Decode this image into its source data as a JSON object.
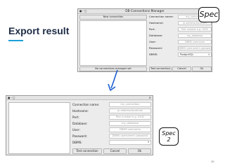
{
  "slide": {
    "title": "Export result",
    "page_number": "10"
  },
  "window_top": {
    "title": "DB Connections Manager",
    "controls": "●–▢",
    "close": "✕",
    "new_connection_button": "New connection",
    "no_connection_button": "No connections manager set",
    "form": [
      {
        "label": "Connection name:",
        "placeholder": "my_connection"
      },
      {
        "label": "Hostname:",
        "placeholder": "ip address/localhost"
      },
      {
        "label": "Port:",
        "placeholder": "Port number e.g. 5432"
      },
      {
        "label": "Database:",
        "placeholder": "my_database"
      },
      {
        "label": "User:",
        "placeholder": "DBMS username"
      },
      {
        "label": "Password:",
        "placeholder": "DBMS username's password"
      },
      {
        "label": "DBMS:",
        "value": "PostgreSQL"
      }
    ],
    "buttons": {
      "test_connection": "Test connection",
      "cancel": "Cancel",
      "ok": "Ok"
    }
  },
  "window_bottom": {
    "controls": "●–▢",
    "close": "✕",
    "form": [
      {
        "label": "Connection name:",
        "placeholder": "my_connection"
      },
      {
        "label": "Hostname:",
        "placeholder": "ip address/localhost"
      },
      {
        "label": "Port:",
        "placeholder": "Port number e.g. 5432"
      },
      {
        "label": "Database:",
        "placeholder": "my_database"
      },
      {
        "label": "User:",
        "placeholder": "DBMS username"
      },
      {
        "label": "Password:",
        "placeholder": "DBMS username's password"
      },
      {
        "label": "DBMS:",
        "value": ""
      }
    ],
    "buttons": {
      "test_connection": "Test connection",
      "cancel": "Cancel",
      "ok": "Ok"
    }
  },
  "badges": {
    "top": {
      "line1": "Spec"
    },
    "bottom": {
      "line1": "Spec",
      "line2": "2"
    }
  },
  "icons": {
    "arrow": "down-arrow-icon"
  }
}
